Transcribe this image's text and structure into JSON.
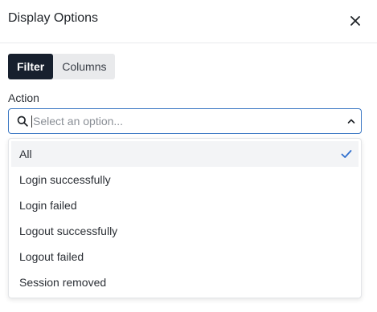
{
  "dialog": {
    "title": "Display Options",
    "close_icon": "close-icon"
  },
  "tabs": [
    {
      "label": "Filter",
      "active": true
    },
    {
      "label": "Columns",
      "active": false
    }
  ],
  "filter": {
    "label": "Action",
    "placeholder": "Select an option...",
    "value": "",
    "expanded": true,
    "options": [
      {
        "label": "All",
        "selected": true
      },
      {
        "label": "Login successfully",
        "selected": false
      },
      {
        "label": "Login failed",
        "selected": false
      },
      {
        "label": "Logout successfully",
        "selected": false
      },
      {
        "label": "Logout failed",
        "selected": false
      },
      {
        "label": "Session removed",
        "selected": false
      }
    ]
  },
  "colors": {
    "accent": "#3b78c4",
    "active_tab_bg": "#17202e",
    "check": "#2f6fce"
  }
}
